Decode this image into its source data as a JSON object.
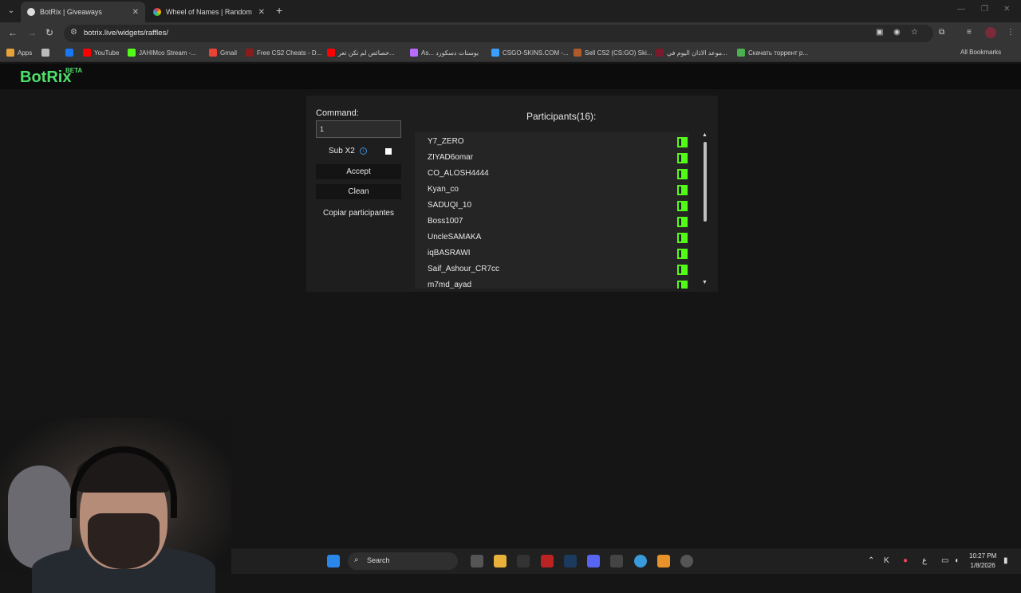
{
  "browser": {
    "tabs": [
      {
        "title": "BotRix | Giveaways",
        "active": true
      },
      {
        "title": "Wheel of Names | Random nam",
        "active": false
      }
    ],
    "new_tab_symbol": "+",
    "url": "botrix.live/widgets/raffles/",
    "bookmarks": [
      {
        "label": "Apps",
        "color": "#e8a23a"
      },
      {
        "label": "",
        "color": "#bbbbbb"
      },
      {
        "label": "",
        "color": "#1877f2"
      },
      {
        "label": "YouTube",
        "color": "#ff0000"
      },
      {
        "label": "JAHIMco Stream -...",
        "color": "#53fc18"
      },
      {
        "label": "Gmail",
        "color": "#ea4335"
      },
      {
        "label": "Free CS2 Cheats - D...",
        "color": "#8a1c1c"
      },
      {
        "label": "خصائص لم تكن تعر...",
        "color": "#ff0000"
      },
      {
        "label": "As... بوستات دسكورد",
        "color": "#b86bff"
      },
      {
        "label": "CSGO-SKINS.COM -...",
        "color": "#3aa0ff"
      },
      {
        "label": "Sell CS2 (CS:GO) Ski...",
        "color": "#b05a2a"
      },
      {
        "label": "موعد الاذان اليوم في...",
        "color": "#7a1a2a"
      },
      {
        "label": "Скачать торрент р...",
        "color": "#4caf50"
      }
    ],
    "all_bookmarks": "All Bookmarks"
  },
  "app": {
    "logo": "BotRix",
    "logo_badge": "BETA"
  },
  "raffle": {
    "command_label": "Command:",
    "command_value": "1",
    "sub_label": "Sub X2",
    "info_glyph": "i",
    "accept_label": "Accept",
    "clean_label": "Clean",
    "copy_label": "Copiar participantes",
    "participants_title": "Participants(16):",
    "participants": [
      "Y7_ZERO",
      "ZIYAD6omar",
      "CO_ALOSH4444",
      "Kyan_co",
      "SADUQI_10",
      "Boss1007",
      "UncleSAMAKA",
      "iqBASRAWI",
      "Saif_Ashour_CR7cc",
      "m7md_ayad"
    ],
    "platform_icon": "kick-icon",
    "platform_color": "#53fc18"
  },
  "taskbar": {
    "search_label": "Search",
    "lang": "ع",
    "time": "10:27 PM",
    "date": "1/8/2026"
  }
}
